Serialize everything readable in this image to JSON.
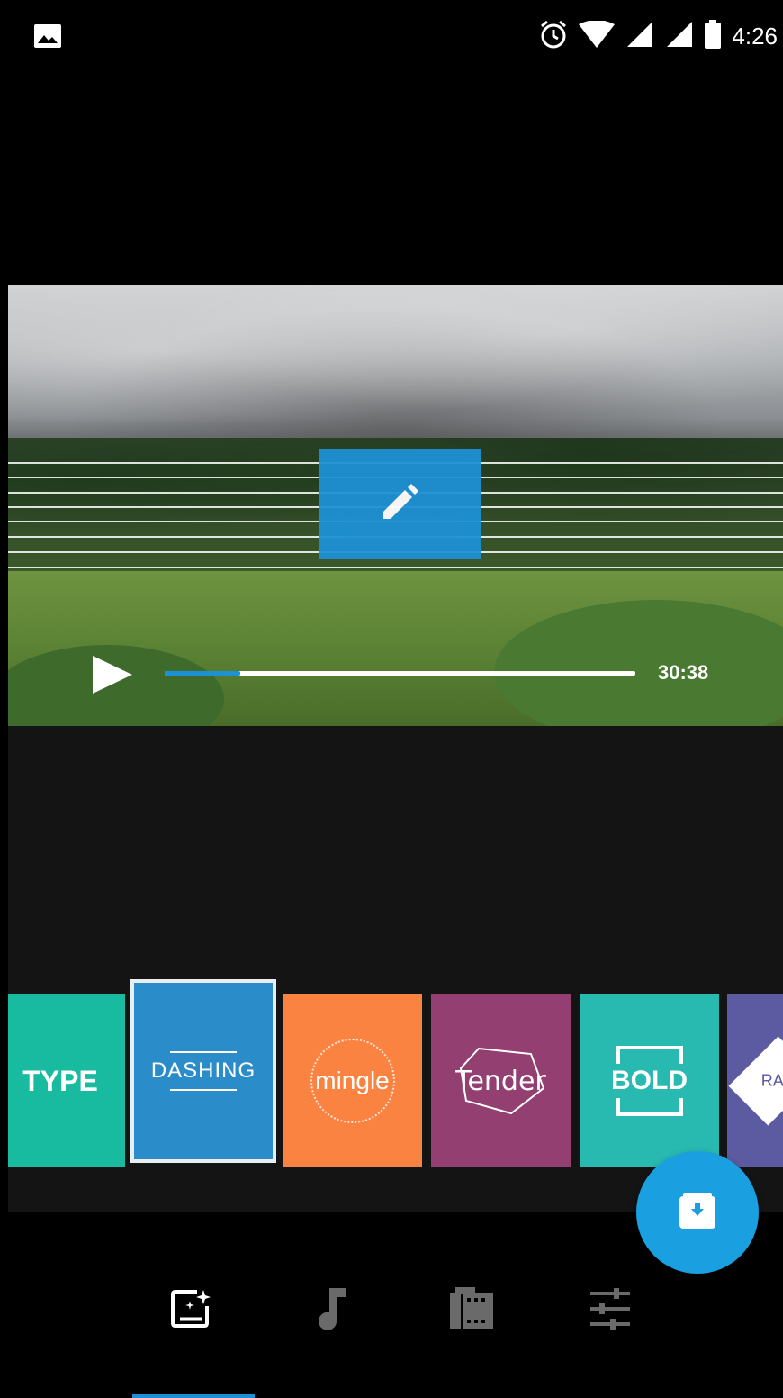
{
  "status_bar": {
    "time": "4:26",
    "icons": [
      "image-icon",
      "alarm-icon",
      "wifi-icon",
      "signal-icon",
      "signal-icon-2",
      "battery-icon"
    ]
  },
  "player": {
    "time": "30:38",
    "progress": 0.16,
    "edit_icon": "pencil-icon",
    "play_icon": "play-icon"
  },
  "themes": [
    {
      "label": "TYPE",
      "color": "#19bba0",
      "selected": false
    },
    {
      "label": "DASHING",
      "color": "#2a8cc8",
      "selected": true
    },
    {
      "label": "mingle",
      "color": "#fb8342",
      "selected": false
    },
    {
      "label": "Tender",
      "color": "#933f72",
      "selected": false
    },
    {
      "label": "BOLD",
      "color": "#28b9b1",
      "selected": false
    },
    {
      "label": "RA",
      "color": "#5c5aa0",
      "selected": false
    }
  ],
  "fab": {
    "icon": "save-download-icon",
    "color": "#1a9fe0"
  },
  "bottom_nav": {
    "items": [
      "themes-icon",
      "music-icon",
      "clips-icon",
      "adjust-icon"
    ],
    "active_index": 0,
    "accent": "#1e90d4"
  }
}
